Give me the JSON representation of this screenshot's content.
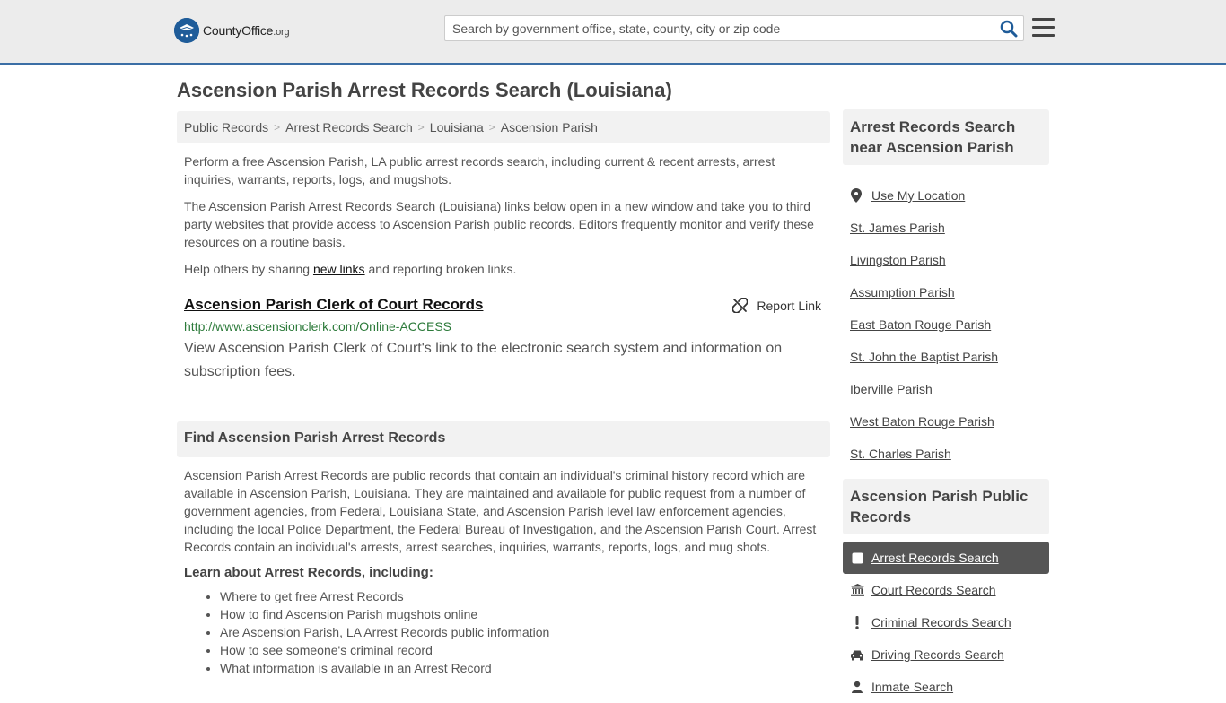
{
  "header": {
    "logo_name": "CountyOffice",
    "logo_suffix": ".org",
    "search_placeholder": "Search by government office, state, county, city or zip code"
  },
  "page": {
    "title": "Ascension Parish Arrest Records Search (Louisiana)"
  },
  "breadcrumb": [
    "Public Records",
    "Arrest Records Search",
    "Louisiana",
    "Ascension Parish"
  ],
  "intro": {
    "p1": "Perform a free Ascension Parish, LA public arrest records search, including current & recent arrests, arrest inquiries, warrants, reports, logs, and mugshots.",
    "p2": "The Ascension Parish Arrest Records Search (Louisiana) links below open in a new window and take you to third party websites that provide access to Ascension Parish public records. Editors frequently monitor and verify these resources on a routine basis.",
    "p3_prefix": "Help others by sharing ",
    "p3_link": "new links",
    "p3_suffix": " and reporting broken links."
  },
  "record": {
    "title": "Ascension Parish Clerk of Court Records",
    "report_label": "Report Link",
    "url": "http://www.ascensionclerk.com/Online-ACCESS",
    "desc": "View Ascension Parish Clerk of Court's link to the electronic search system and information on subscription fees."
  },
  "find_section": {
    "heading": "Find Ascension Parish Arrest Records",
    "text": "Ascension Parish Arrest Records are public records that contain an individual's criminal history record which are available in Ascension Parish, Louisiana. They are maintained and available for public request from a number of government agencies, from Federal, Louisiana State, and Ascension Parish level law enforcement agencies, including the local Police Department, the Federal Bureau of Investigation, and the Ascension Parish Court. Arrest Records contain an individual's arrests, arrest searches, inquiries, warrants, reports, logs, and mug shots.",
    "learn_heading": "Learn about Arrest Records, including:",
    "learn_items": [
      "Where to get free Arrest Records",
      "How to find Ascension Parish mugshots online",
      "Are Ascension Parish, LA Arrest Records public information",
      "How to see someone's criminal record",
      "What information is available in an Arrest Record"
    ]
  },
  "sidebar": {
    "near_heading": "Arrest Records Search near Ascension Parish",
    "use_location": "Use My Location",
    "near_items": [
      "St. James Parish",
      "Livingston Parish",
      "Assumption Parish",
      "East Baton Rouge Parish",
      "St. John the Baptist Parish",
      "Iberville Parish",
      "West Baton Rouge Parish",
      "St. Charles Parish"
    ],
    "public_heading": "Ascension Parish Public Records",
    "public_items": [
      {
        "label": "Arrest Records Search",
        "icon": "square-icon"
      },
      {
        "label": "Court Records Search",
        "icon": "courthouse-icon"
      },
      {
        "label": "Criminal Records Search",
        "icon": "exclamation-icon"
      },
      {
        "label": "Driving Records Search",
        "icon": "car-icon"
      },
      {
        "label": "Inmate Search",
        "icon": "person-icon"
      }
    ]
  },
  "colors": {
    "brand_blue": "#1f5c99",
    "url_green": "#2c7a3a",
    "active_bg": "#555555"
  }
}
